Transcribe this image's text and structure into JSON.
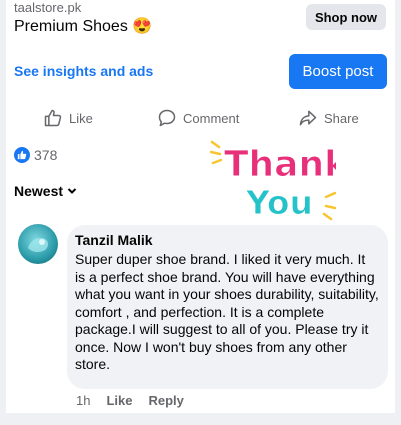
{
  "post": {
    "domain": "taalstore.pk",
    "title": "Premium Shoes 😍",
    "shop_button": "Shop now"
  },
  "insights": {
    "link_label": "See insights and ads",
    "boost_label": "Boost post"
  },
  "actions": {
    "like": "Like",
    "comment": "Comment",
    "share": "Share"
  },
  "reactions": {
    "count": "378"
  },
  "sort": {
    "label": "Newest"
  },
  "sticker": {
    "line1": "Thank",
    "line2": "You"
  },
  "comment": {
    "author": "Tanzil Malik",
    "text": "Super duper shoe brand. I liked it very much. It is a perfect shoe brand. You will have everything what  you want in your shoes durability, suitability, comfort , and perfection. It is a complete package.I will suggest to all of you. Please try it once. Now I won't buy shoes from any other store.",
    "time": "1h",
    "like": "Like",
    "reply": "Reply"
  },
  "colors": {
    "accent": "#1877f2",
    "sticker_pink": "#e8307a",
    "sticker_teal": "#25c3c9",
    "sticker_yellow": "#f7c531"
  }
}
